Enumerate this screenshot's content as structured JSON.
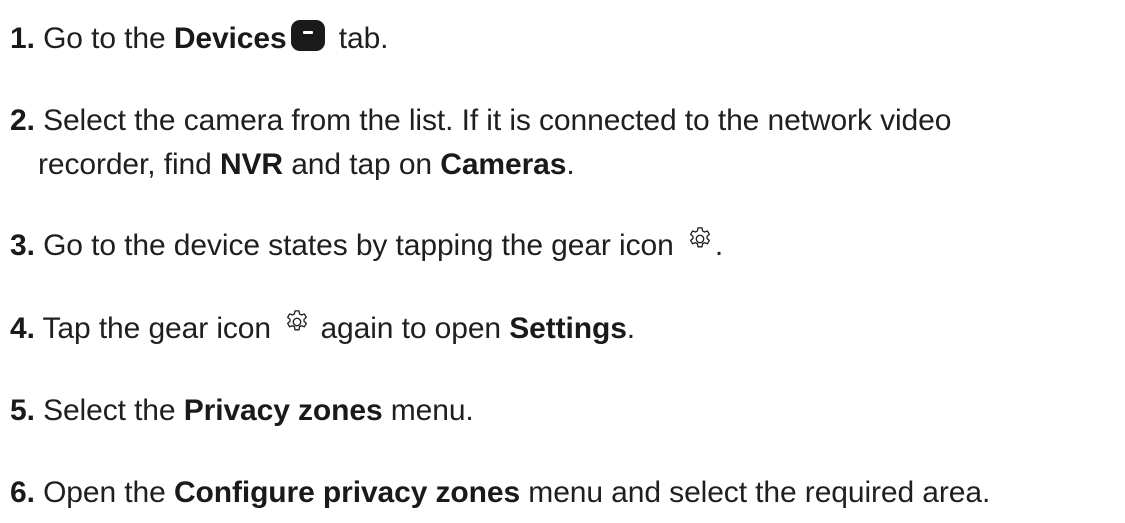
{
  "steps": [
    {
      "number": "1.",
      "text_before": " Go to the ",
      "bold": "Devices",
      "text_after": " tab.",
      "icon": "devices-tab-icon"
    },
    {
      "number": "2.",
      "line1": " Select the camera from the list. If it is connected to the network video",
      "line2_before": "recorder, find ",
      "bold_nvr": "NVR",
      "line2_middle": " and tap on ",
      "bold_cameras": "Cameras",
      "line2_after": "."
    },
    {
      "number": "3.",
      "text_before": " Go to the device states by tapping the gear icon ",
      "text_after": ".",
      "icon": "gear-icon"
    },
    {
      "number": "4.",
      "text_before": " Tap the gear icon ",
      "text_middle": " again to open ",
      "bold": "Settings",
      "text_after": ".",
      "icon": "gear-icon"
    },
    {
      "number": "5.",
      "text_before": " Select the ",
      "bold": "Privacy zones",
      "text_after": " menu."
    },
    {
      "number": "6.",
      "text_before": " Open the ",
      "bold": "Configure privacy zones",
      "text_after": " menu and select the required area."
    }
  ],
  "colors": {
    "text": "#1f1f1f",
    "icon": "#1a1a1a",
    "background": "#ffffff"
  }
}
